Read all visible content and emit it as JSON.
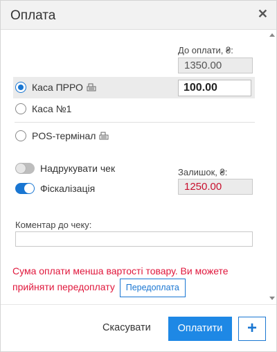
{
  "dialog": {
    "title": "Оплата",
    "close_icon": "close-icon"
  },
  "payment": {
    "due_label": "До оплати, ₴:",
    "due_value": "1350.00",
    "remainder_label": "Залишок, ₴:",
    "remainder_value": "1250.00",
    "amount_value": "100.00"
  },
  "methods": [
    {
      "label": "Каса ПРРО",
      "selected": true,
      "icon": "cash-register-icon"
    },
    {
      "label": "Каса №1",
      "selected": false
    },
    {
      "label": "POS-термінал",
      "selected": false,
      "icon": "cash-register-icon"
    }
  ],
  "toggles": {
    "print_receipt_label": "Надрукувати чек",
    "print_receipt_on": false,
    "fiscalization_label": "Фіскалізація",
    "fiscalization_on": true
  },
  "comment": {
    "label": "Коментар до чеку:",
    "value": ""
  },
  "warning": {
    "text": "Сума оплати менша вартості товару. Ви можете прийняти передоплату",
    "prepay_button": "Передоплата"
  },
  "footer": {
    "cancel_label": "Скасувати",
    "pay_label": "Оплатити",
    "add_label": "+"
  },
  "colors": {
    "accent": "#1976d2",
    "warning": "#e0173c",
    "remainder": "#c8102e"
  }
}
